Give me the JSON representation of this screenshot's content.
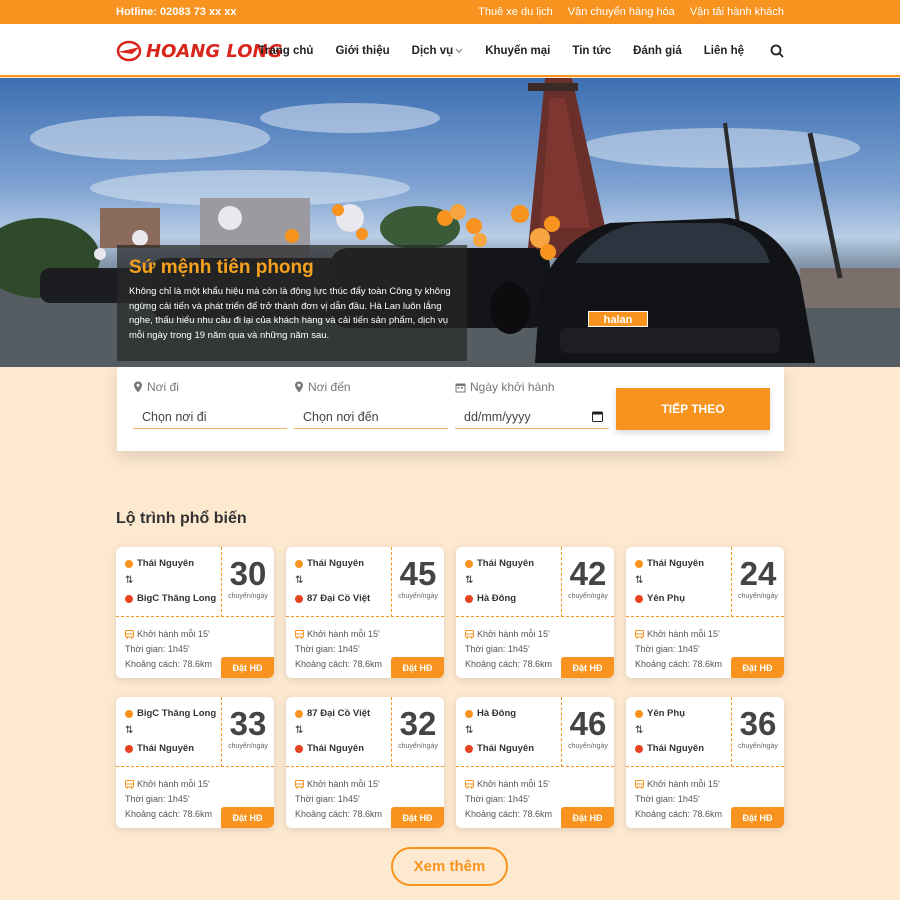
{
  "topbar": {
    "hotline": "Hotline: 02083 73 xx xx",
    "links": [
      "Thuê xe du lịch",
      "Vận chuyển hàng hóa",
      "Vận tải hành khách"
    ]
  },
  "header": {
    "logo_text": "HOANG LONG",
    "menu": [
      "Trang chủ",
      "Giới thiệu",
      "Dịch vụ",
      "Khuyến mại",
      "Tin tức",
      "Đánh giá",
      "Liên hệ"
    ]
  },
  "hero": {
    "title": "Sứ mệnh tiên phong",
    "description": "Không chỉ là một khẩu hiệu mà còn là động lực thúc đẩy toàn Công ty không ngừng cải tiến và phát triển để trở thành đơn vị dẫn đầu. Hà Lan luôn lắng nghe, thấu hiểu nhu cầu đi lại của khách hàng và cải tiến sản phẩm, dịch vụ mỗi ngày trong 19 năm qua và những năm sau.",
    "plate": "halan"
  },
  "search": {
    "from_label": "Nơi đi",
    "from_placeholder": "Chọn nơi đi",
    "to_label": "Nơi đến",
    "to_placeholder": "Chọn nơi đến",
    "date_label": "Ngày khởi hành",
    "date_placeholder": "dd/mm/yyyy",
    "submit": "TIẾP THEO"
  },
  "routes_title": "Lộ trình phổ biến",
  "route_labels": {
    "unit": "chuyến/ngày",
    "depart": "Khởi hành mỗi 15'",
    "duration": "Thời gian: 1h45'",
    "distance": "Khoảng cách: 78.6km",
    "book": "Đặt HĐ",
    "swap": "⇅"
  },
  "routes": [
    {
      "from": "Thái Nguyên",
      "to": "BigC Thăng Long",
      "trips": "30"
    },
    {
      "from": "Thái Nguyên",
      "to": "87 Đại Cồ Việt",
      "trips": "45"
    },
    {
      "from": "Thái Nguyên",
      "to": "Hà Đông",
      "trips": "42"
    },
    {
      "from": "Thái Nguyên",
      "to": "Yên Phụ",
      "trips": "24"
    },
    {
      "from": "BigC Thăng Long",
      "to": "Thái Nguyên",
      "trips": "33"
    },
    {
      "from": "87 Đại Cồ Việt",
      "to": "Thái Nguyên",
      "trips": "32"
    },
    {
      "from": "Hà Đông",
      "to": "Thái Nguyên",
      "trips": "46"
    },
    {
      "from": "Yên Phụ",
      "to": "Thái Nguyên",
      "trips": "36"
    }
  ],
  "more_button": "Xem thêm",
  "colors": {
    "accent": "#f7931e",
    "logo_red": "#d9261c",
    "page_bg": "#fde9d0"
  }
}
